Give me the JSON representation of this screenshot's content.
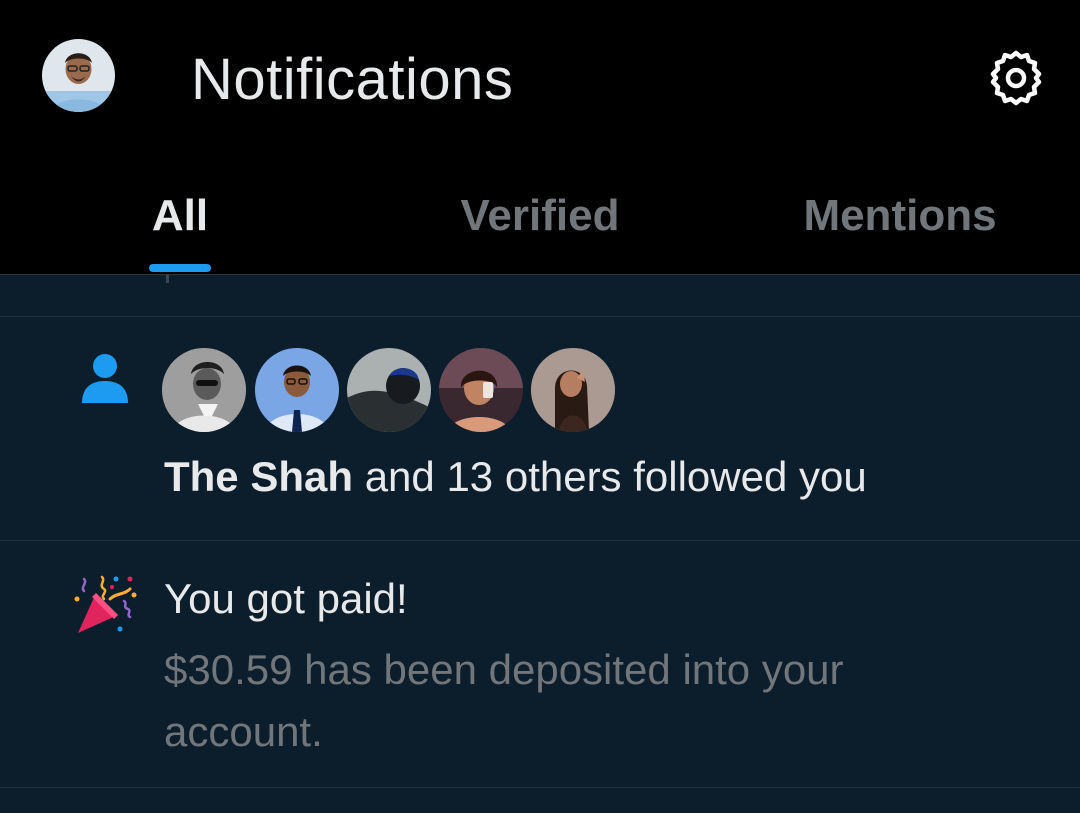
{
  "header": {
    "title": "Notifications",
    "avatar_icon": "user-avatar",
    "settings_icon": "gear-icon"
  },
  "tabs": [
    {
      "label": "All",
      "active": true
    },
    {
      "label": "Verified",
      "active": false
    },
    {
      "label": "Mentions",
      "active": false
    }
  ],
  "notifications": {
    "follow": {
      "icon": "person-icon",
      "name": "The Shah",
      "text": " and 13 others followed you"
    },
    "payment": {
      "icon": "party-popper-icon",
      "title": "You got paid!",
      "body": "$30.59 has been deposited into your account."
    }
  },
  "colors": {
    "accent": "#1d9bf0",
    "background": "#0c1d2b",
    "header_background": "#000000",
    "text_primary": "#e7e9ea",
    "text_secondary": "#71767b"
  }
}
